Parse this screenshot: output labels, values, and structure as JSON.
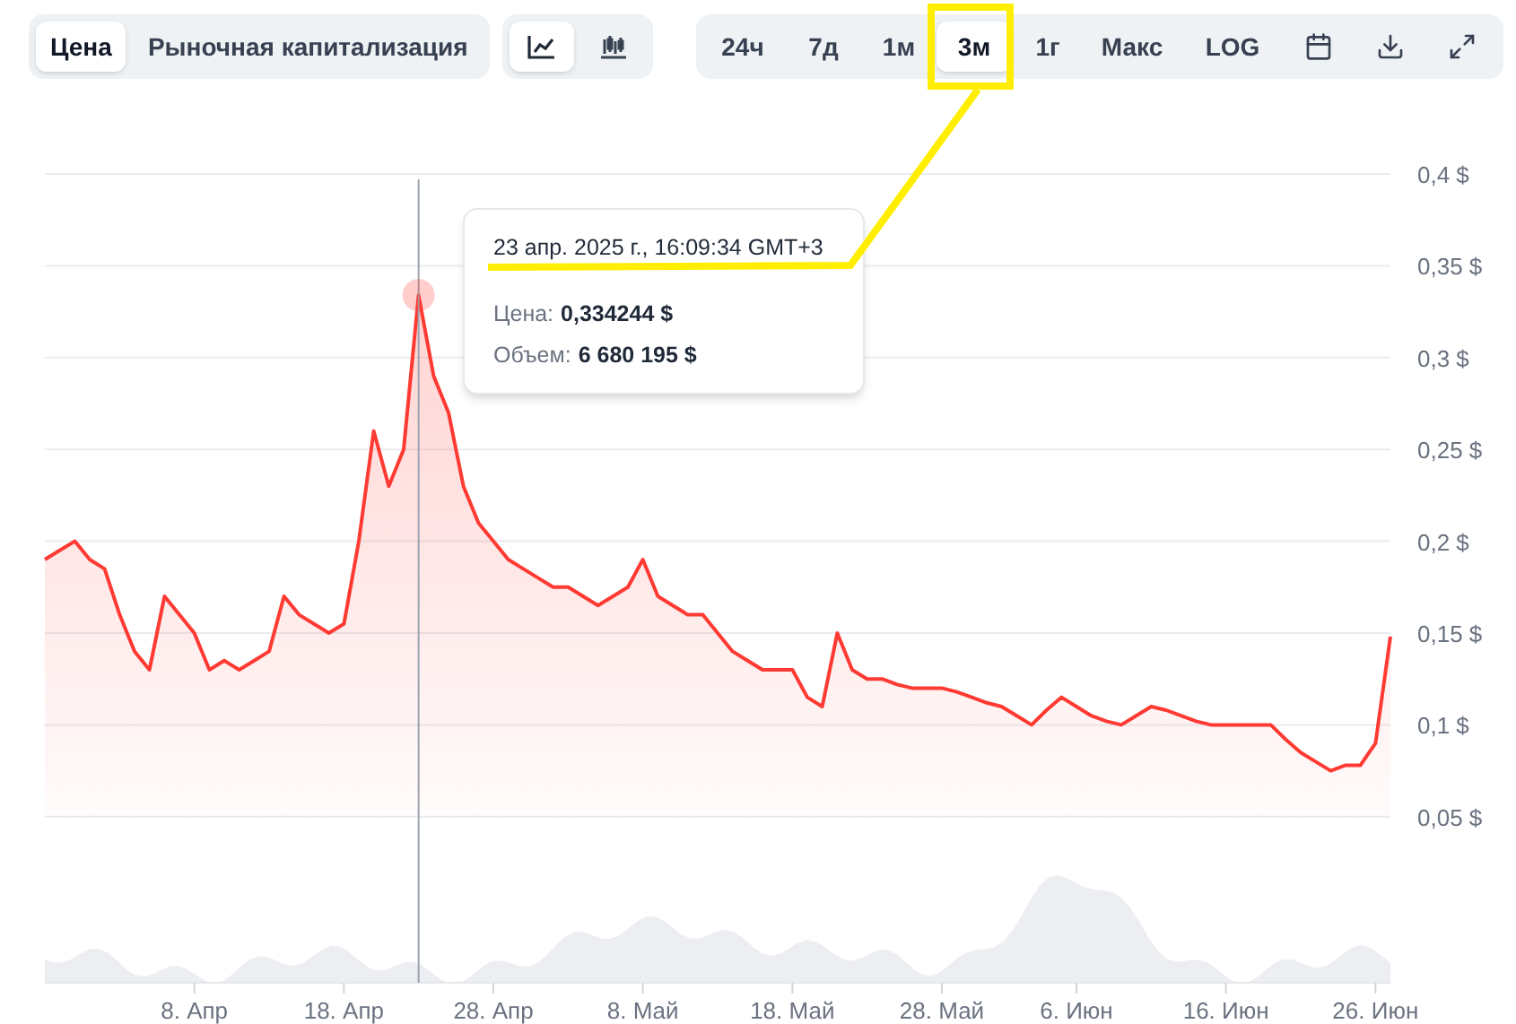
{
  "tabs": [
    {
      "label": "Цена",
      "selected": true
    },
    {
      "label": "Рыночная капитализация",
      "selected": false
    }
  ],
  "chart_types": [
    {
      "kind": "line",
      "selected": true
    },
    {
      "kind": "candles",
      "selected": false
    }
  ],
  "ranges": [
    {
      "label": "24ч",
      "selected": false
    },
    {
      "label": "7д",
      "selected": false
    },
    {
      "label": "1м",
      "selected": false
    },
    {
      "label": "3м",
      "selected": true
    },
    {
      "label": "1г",
      "selected": false
    },
    {
      "label": "Макс",
      "selected": false
    },
    {
      "label": "LOG",
      "selected": false
    }
  ],
  "tooltip": {
    "date": "23 апр. 2025 г., 16:09:34 GMT+3",
    "rows": [
      {
        "label": "Цена:",
        "value": "0,334244 $"
      },
      {
        "label": "Объем:",
        "value": "6 680 195 $"
      }
    ]
  },
  "chart_data": {
    "type": "area",
    "grid": true,
    "ylim": [
      0.05,
      0.4
    ],
    "categories": [
      null,
      null,
      null,
      null,
      null,
      null,
      null,
      null,
      null,
      null,
      "8. Апр",
      null,
      null,
      null,
      null,
      null,
      null,
      null,
      null,
      null,
      "18. Апр",
      null,
      null,
      null,
      null,
      null,
      null,
      null,
      null,
      null,
      "28. Апр",
      null,
      null,
      null,
      null,
      null,
      null,
      null,
      null,
      null,
      "8. Май",
      null,
      null,
      null,
      null,
      null,
      null,
      null,
      null,
      null,
      "18. Май",
      null,
      null,
      null,
      null,
      null,
      null,
      null,
      null,
      null,
      "28. Май",
      null,
      null,
      null,
      null,
      null,
      null,
      null,
      null,
      "6. Июн",
      null,
      null,
      null,
      null,
      null,
      null,
      null,
      null,
      null,
      "16. Июн",
      null,
      null,
      null,
      null,
      null,
      null,
      null,
      null,
      null,
      "26. Июн",
      null
    ],
    "series": [
      {
        "color": "#ff3a33",
        "values": [
          0.19,
          0.195,
          0.2,
          0.19,
          0.185,
          0.16,
          0.14,
          0.13,
          0.17,
          0.16,
          0.15,
          0.13,
          0.135,
          0.13,
          0.135,
          0.14,
          0.17,
          0.16,
          0.155,
          0.15,
          0.155,
          0.2,
          0.26,
          0.23,
          0.25,
          0.334,
          0.29,
          0.27,
          0.23,
          0.21,
          0.2,
          0.19,
          0.185,
          0.18,
          0.175,
          0.175,
          0.17,
          0.165,
          0.17,
          0.175,
          0.19,
          0.17,
          0.165,
          0.16,
          0.16,
          0.15,
          0.14,
          0.135,
          0.13,
          0.13,
          0.13,
          0.115,
          0.11,
          0.15,
          0.13,
          0.125,
          0.125,
          0.122,
          0.12,
          0.12,
          0.12,
          0.118,
          0.115,
          0.112,
          0.11,
          0.105,
          0.1,
          0.108,
          0.115,
          0.11,
          0.105,
          0.102,
          0.1,
          0.105,
          0.11,
          0.108,
          0.105,
          0.102,
          0.1,
          0.1,
          0.1,
          0.1,
          0.1,
          0.092,
          0.085,
          0.08,
          0.075,
          0.078,
          0.078,
          0.09,
          0.148
        ]
      }
    ],
    "yticks": [
      {
        "value": 0.05,
        "label": "0,05 $"
      },
      {
        "value": 0.1,
        "label": "0,1 $"
      },
      {
        "value": 0.15,
        "label": "0,15 $"
      },
      {
        "value": 0.2,
        "label": "0,2 $"
      },
      {
        "value": 0.25,
        "label": "0,25 $"
      },
      {
        "value": 0.3,
        "label": "0,3 $"
      },
      {
        "value": 0.35,
        "label": "0,35 $"
      },
      {
        "value": 0.4,
        "label": "0,4 $"
      }
    ]
  }
}
